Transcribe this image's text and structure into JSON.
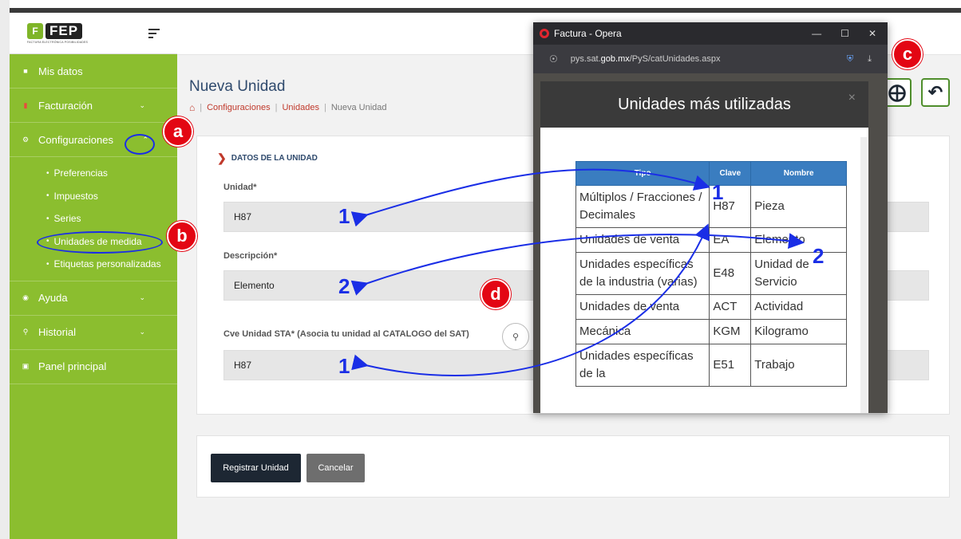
{
  "logo": {
    "text": "FEP",
    "icon": "F",
    "tagline": "FACTURA ELECTRÓNICA POSIBILIDADES"
  },
  "sidebar": {
    "items": [
      {
        "label": "Mis datos",
        "icon": "user-icon"
      },
      {
        "label": "Facturación",
        "icon": "file-icon"
      },
      {
        "label": "Configuraciones",
        "icon": "gear-icon"
      },
      {
        "label": "Ayuda",
        "icon": "lifebuoy-icon"
      },
      {
        "label": "Historial",
        "icon": "search-icon"
      },
      {
        "label": "Panel principal",
        "icon": "monitor-icon"
      }
    ],
    "submenu": [
      "Preferencias",
      "Impuestos",
      "Series",
      "Unidades de medida",
      "Etiquetas personalizadas"
    ]
  },
  "page": {
    "title": "Nueva Unidad",
    "breadcrumb": [
      "Configuraciones",
      "Unidades",
      "Nueva Unidad"
    ]
  },
  "form": {
    "section_title": "DATOS DE LA UNIDAD",
    "unidad_label": "Unidad*",
    "unidad_value": "H87",
    "descripcion_label": "Descripción*",
    "descripcion_value": "Elemento",
    "cve_label": "Cve Unidad STA* (Asocia tu unidad al CATALOGO del SAT)",
    "cve_value": "H87"
  },
  "buttons": {
    "register": "Registrar Unidad",
    "cancel": "Cancelar"
  },
  "popup": {
    "window_title": "Factura - Opera",
    "url_prefix": "pys.sat.",
    "url_domain": "gob.mx",
    "url_path": "/PyS/catUnidades.aspx",
    "modal_title": "Unidades más utilizadas",
    "table": {
      "headers": [
        "Tipo",
        "Clave",
        "Nombre"
      ],
      "rows": [
        [
          "Múltiplos / Fracciones / Decimales",
          "H87",
          "Pieza"
        ],
        [
          "Unidades de venta",
          "EA",
          "Elemento"
        ],
        [
          "Unidades específicas de la industria (varias)",
          "E48",
          "Unidad de Servicio"
        ],
        [
          "Unidades de venta",
          "ACT",
          "Actividad"
        ],
        [
          "Mecánica",
          "KGM",
          "Kilogramo"
        ],
        [
          "Unidades específicas de la",
          "E51",
          "Trabajo"
        ]
      ]
    }
  },
  "annotations": {
    "badges": [
      "a",
      "b",
      "c",
      "d"
    ],
    "numbers": [
      "1",
      "1",
      "1",
      "2",
      "2"
    ]
  },
  "colors": {
    "sidebar": "#8bbe2f",
    "accent": "#c0392b",
    "annotation": "#1a2ee6",
    "badge": "#e30613"
  }
}
